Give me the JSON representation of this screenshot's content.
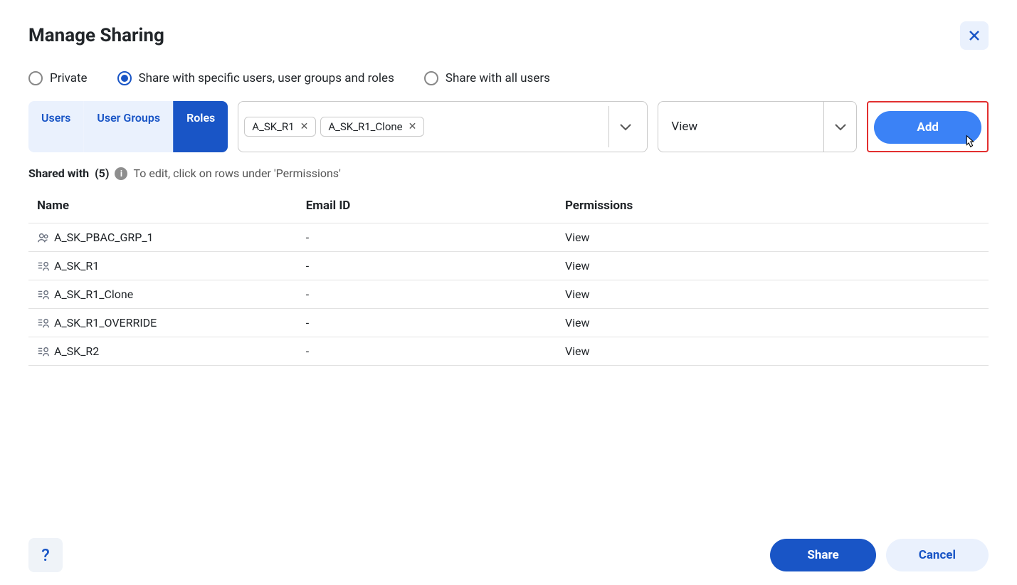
{
  "title": "Manage Sharing",
  "radios": {
    "private": "Private",
    "specific": "Share with specific users, user groups and roles",
    "all": "Share with all users",
    "selected": "specific"
  },
  "tabs": {
    "users": "Users",
    "groups": "User Groups",
    "roles": "Roles",
    "active": "roles"
  },
  "multiselect": {
    "chips": [
      {
        "label": "A_SK_R1"
      },
      {
        "label": "A_SK_R1_Clone"
      }
    ]
  },
  "permission_select": {
    "value": "View"
  },
  "add_button": "Add",
  "shared_with": {
    "label": "Shared with",
    "count": "(5)",
    "hint": "To edit, click on rows under 'Permissions'"
  },
  "table": {
    "headers": {
      "name": "Name",
      "email": "Email ID",
      "permissions": "Permissions"
    },
    "rows": [
      {
        "icon": "group",
        "name": "A_SK_PBAC_GRP_1",
        "email": "-",
        "perm": "View"
      },
      {
        "icon": "role",
        "name": "A_SK_R1",
        "email": "-",
        "perm": "View"
      },
      {
        "icon": "role",
        "name": "A_SK_R1_Clone",
        "email": "-",
        "perm": "View"
      },
      {
        "icon": "role",
        "name": "A_SK_R1_OVERRIDE",
        "email": "-",
        "perm": "View"
      },
      {
        "icon": "role",
        "name": "A_SK_R2",
        "email": "-",
        "perm": "View"
      }
    ]
  },
  "footer": {
    "help": "?",
    "share": "Share",
    "cancel": "Cancel"
  }
}
